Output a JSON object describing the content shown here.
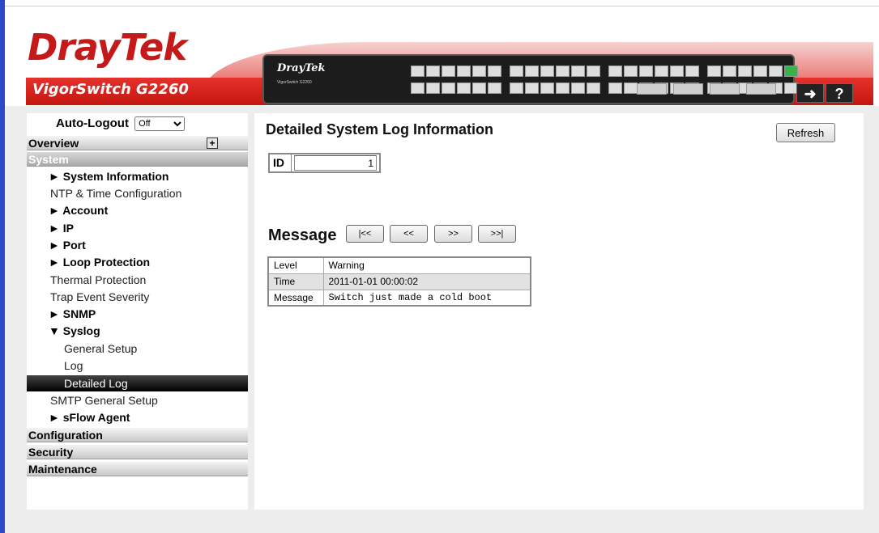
{
  "header": {
    "brand": "DrayTek",
    "model": "VigorSwitch G2260",
    "panel_brand": "DrayTek",
    "panel_sub": "VigorSwitch G2260",
    "logout_icon": "logout-icon",
    "help_label": "?"
  },
  "sidebar": {
    "autologout_label": "Auto-Logout",
    "autologout_value": "Off",
    "sections": {
      "overview": "Overview",
      "system": "System",
      "configuration": "Configuration",
      "security": "Security",
      "maintenance": "Maintenance"
    },
    "items": [
      "► System Information",
      "NTP & Time Configuration",
      "► Account",
      "► IP",
      "► Port",
      "► Loop Protection",
      "Thermal Protection",
      "Trap Event Severity",
      "► SNMP",
      "▼ Syslog",
      "General Setup",
      "Log",
      "Detailed Log",
      "SMTP General Setup",
      "► sFlow Agent"
    ]
  },
  "main": {
    "title": "Detailed System Log Information",
    "refresh_label": "Refresh",
    "id_label": "ID",
    "id_value": "1",
    "message_title": "Message",
    "nav": {
      "first": "|<<",
      "prev": "<<",
      "next": ">>",
      "last": ">>|"
    },
    "log": {
      "level_label": "Level",
      "level_value": "Warning",
      "time_label": "Time",
      "time_value": "2011-01-01 00:00:02",
      "message_label": "Message",
      "message_value": "Switch just made a cold boot"
    }
  }
}
